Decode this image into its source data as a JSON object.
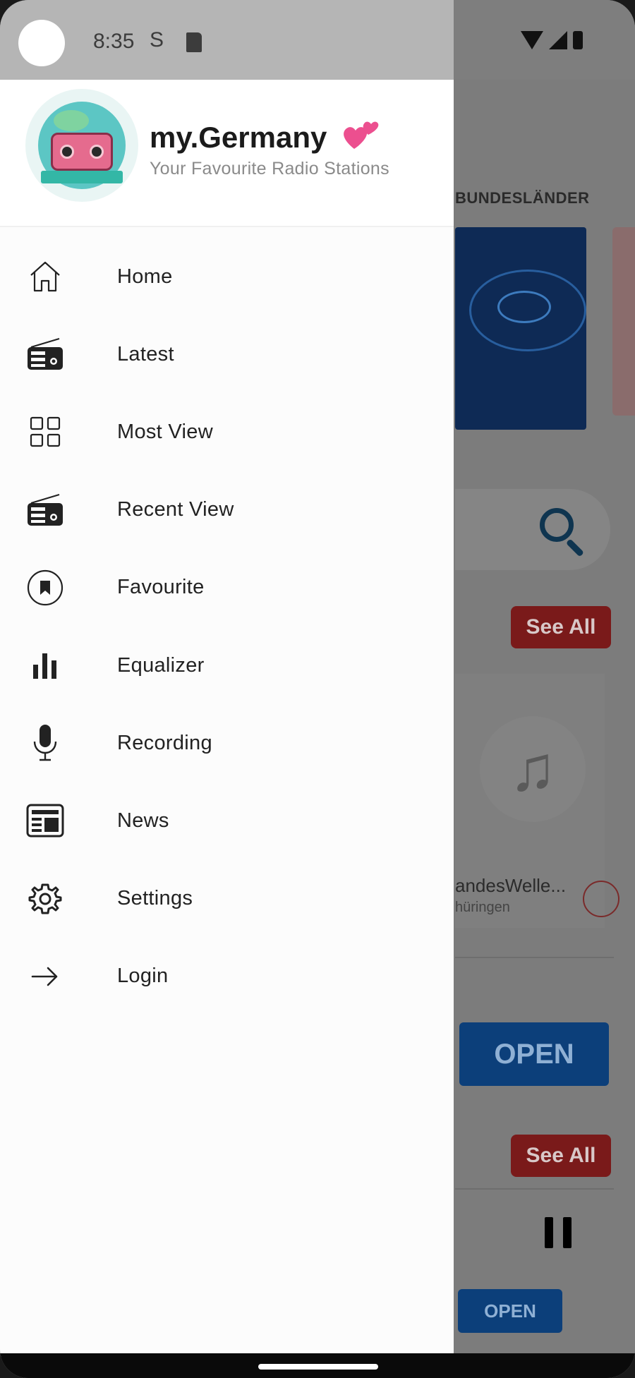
{
  "status_bar": {
    "time": "8:35",
    "s_icon": "S"
  },
  "drawer": {
    "app_title": "my.Germany",
    "app_subtitle": "Your Favourite Radio Stations",
    "menu": [
      {
        "label": "Home",
        "icon": "home-icon"
      },
      {
        "label": "Latest",
        "icon": "radio-icon"
      },
      {
        "label": "Most View",
        "icon": "grid-icon"
      },
      {
        "label": "Recent View",
        "icon": "radio-icon"
      },
      {
        "label": "Favourite",
        "icon": "bookmark-circle-icon"
      },
      {
        "label": "Equalizer",
        "icon": "equalizer-icon"
      },
      {
        "label": "Recording",
        "icon": "microphone-icon"
      },
      {
        "label": "News",
        "icon": "newspaper-icon"
      },
      {
        "label": "Settings",
        "icon": "gear-icon"
      },
      {
        "label": "Login",
        "icon": "arrow-right-icon"
      }
    ]
  },
  "background": {
    "tab_label": "BUNDESLÄNDER",
    "see_all_1": "See All",
    "see_all_2": "See All",
    "card_title": "andesWelle...",
    "card_subtitle": "hüringen",
    "open_large": "OPEN",
    "open_small": "OPEN"
  },
  "colors": {
    "accent_red": "#d32f2f",
    "open_blue": "#1565c0",
    "drawer_bg": "#fcfcfc"
  }
}
